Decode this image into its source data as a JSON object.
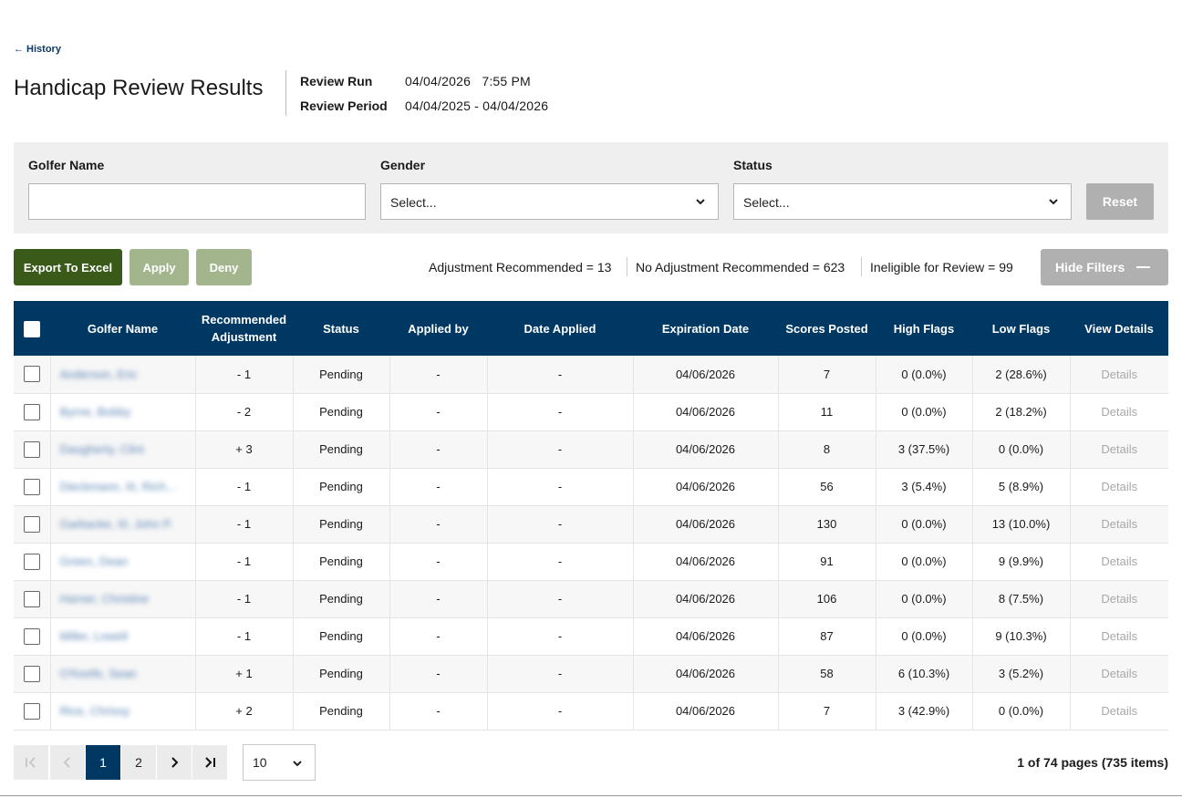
{
  "nav": {
    "back_label": "← History"
  },
  "header": {
    "title": "Handicap Review Results",
    "review_run_label": "Review Run",
    "review_run_value": "04/04/2026   7:55 PM",
    "review_period_label": "Review Period",
    "review_period_value": "04/04/2025 - 04/04/2026"
  },
  "filters": {
    "golfer_name_label": "Golfer Name",
    "golfer_name_value": "",
    "gender_label": "Gender",
    "gender_selected": "Select...",
    "status_label": "Status",
    "status_selected": "Select...",
    "reset_label": "Reset"
  },
  "toolbar": {
    "export_label": "Export To Excel",
    "apply_label": "Apply",
    "deny_label": "Deny",
    "summary_adjustment": "Adjustment Recommended = 13",
    "summary_no_adjustment": "No Adjustment Recommended = 623",
    "summary_ineligible": "Ineligible for Review = 99",
    "hide_filters_label": "Hide Filters"
  },
  "table": {
    "columns": {
      "golfer_name": "Golfer Name",
      "recommended_adjustment": "Recommended Adjustment",
      "status": "Status",
      "applied_by": "Applied by",
      "date_applied": "Date Applied",
      "expiration_date": "Expiration Date",
      "scores_posted": "Scores Posted",
      "high_flags": "High Flags",
      "low_flags": "Low Flags",
      "view_details": "View Details"
    },
    "rows": [
      {
        "name": "Anderson, Eric",
        "adj": "- 1",
        "status": "Pending",
        "applied_by": "-",
        "date_applied": "-",
        "expiration": "04/06/2026",
        "scores": "7",
        "high": "0 (0.0%)",
        "low": "2 (28.6%)",
        "details": "Details"
      },
      {
        "name": "Byrne, Bobby",
        "adj": "- 2",
        "status": "Pending",
        "applied_by": "-",
        "date_applied": "-",
        "expiration": "04/06/2026",
        "scores": "11",
        "high": "0 (0.0%)",
        "low": "2 (18.2%)",
        "details": "Details"
      },
      {
        "name": "Daugherty, Clint",
        "adj": "+ 3",
        "status": "Pending",
        "applied_by": "-",
        "date_applied": "-",
        "expiration": "04/06/2026",
        "scores": "8",
        "high": "3 (37.5%)",
        "low": "0 (0.0%)",
        "details": "Details"
      },
      {
        "name": "Dieckmann, III, Rich...",
        "adj": "- 1",
        "status": "Pending",
        "applied_by": "-",
        "date_applied": "-",
        "expiration": "04/06/2026",
        "scores": "56",
        "high": "3 (5.4%)",
        "low": "5 (8.9%)",
        "details": "Details"
      },
      {
        "name": "Garbacke, III, John P.",
        "adj": "- 1",
        "status": "Pending",
        "applied_by": "-",
        "date_applied": "-",
        "expiration": "04/06/2026",
        "scores": "130",
        "high": "0 (0.0%)",
        "low": "13 (10.0%)",
        "details": "Details"
      },
      {
        "name": "Green, Dean",
        "adj": "- 1",
        "status": "Pending",
        "applied_by": "-",
        "date_applied": "-",
        "expiration": "04/06/2026",
        "scores": "91",
        "high": "0 (0.0%)",
        "low": "9 (9.9%)",
        "details": "Details"
      },
      {
        "name": "Harner, Christine",
        "adj": "- 1",
        "status": "Pending",
        "applied_by": "-",
        "date_applied": "-",
        "expiration": "04/06/2026",
        "scores": "106",
        "high": "0 (0.0%)",
        "low": "8 (7.5%)",
        "details": "Details"
      },
      {
        "name": "Miller, Lowell",
        "adj": "- 1",
        "status": "Pending",
        "applied_by": "-",
        "date_applied": "-",
        "expiration": "04/06/2026",
        "scores": "87",
        "high": "0 (0.0%)",
        "low": "9 (10.3%)",
        "details": "Details"
      },
      {
        "name": "O'Keefe, Sean",
        "adj": "+ 1",
        "status": "Pending",
        "applied_by": "-",
        "date_applied": "-",
        "expiration": "04/06/2026",
        "scores": "58",
        "high": "6 (10.3%)",
        "low": "3 (5.2%)",
        "details": "Details"
      },
      {
        "name": "Rice, Chrissy",
        "adj": "+ 2",
        "status": "Pending",
        "applied_by": "-",
        "date_applied": "-",
        "expiration": "04/06/2026",
        "scores": "7",
        "high": "3 (42.9%)",
        "low": "0 (0.0%)",
        "details": "Details"
      }
    ]
  },
  "pagination": {
    "page_1": "1",
    "page_2": "2",
    "page_size": "10",
    "info": "1 of 74 pages (735 items)"
  },
  "colors": {
    "header_navy": "#003864",
    "export_green": "#3a5a1a",
    "disabled_green": "#a3b58c",
    "disabled_gray": "#b0b0b0",
    "filter_bg": "#efefef"
  },
  "icons": [
    "back-arrow-icon",
    "chevron-down-icon",
    "first-page-icon",
    "prev-page-icon",
    "next-page-icon",
    "last-page-icon",
    "minus-icon",
    "checkbox-icon"
  ]
}
